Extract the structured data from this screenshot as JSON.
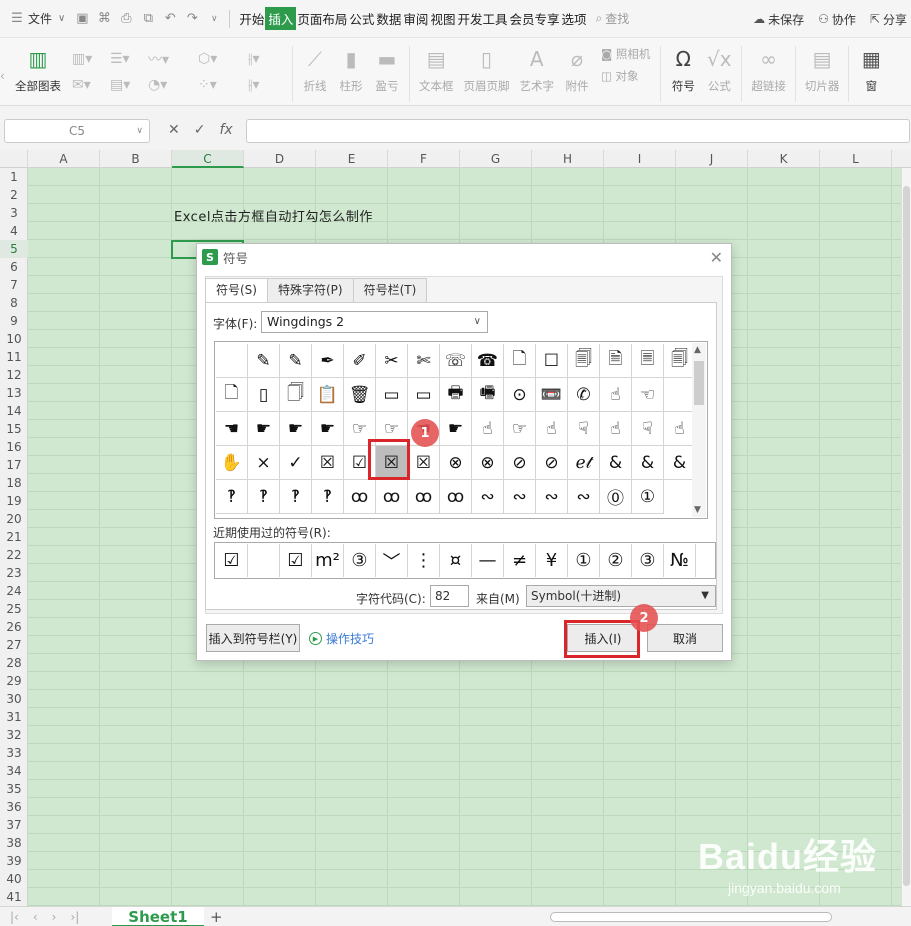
{
  "menubar": {
    "file_label": "文件",
    "tabs": [
      "开始",
      "插入",
      "页面布局",
      "公式",
      "数据",
      "审阅",
      "视图",
      "开发工具",
      "会员专享",
      "选项"
    ],
    "active_tab": "插入",
    "search_label": "查找",
    "unsaved_label": "未保存",
    "collab_label": "协作",
    "share_label": "分享"
  },
  "ribbon": {
    "all_charts": "全部图表",
    "line": "折线",
    "column": "柱形",
    "winloss": "盈亏",
    "textbox": "文本框",
    "header_footer": "页眉页脚",
    "wordart": "艺术字",
    "attachment": "附件",
    "camera": "照相机",
    "object": "对象",
    "symbol": "符号",
    "formula": "公式",
    "hyperlink": "超链接",
    "slicer": "切片器",
    "window": "窗"
  },
  "formula_bar": {
    "name_box": "C5",
    "fx": "fx",
    "value": ""
  },
  "grid": {
    "columns": [
      "A",
      "B",
      "C",
      "D",
      "E",
      "F",
      "G",
      "H",
      "I",
      "J",
      "K",
      "L"
    ],
    "selected_column": "C",
    "rows": [
      "1",
      "2",
      "3",
      "4",
      "5",
      "6",
      "7",
      "8",
      "9",
      "10",
      "11",
      "12",
      "13",
      "14",
      "15",
      "16",
      "17",
      "18",
      "19",
      "20",
      "21",
      "22",
      "23",
      "24",
      "25",
      "26",
      "27",
      "28",
      "29",
      "30",
      "31",
      "32",
      "33",
      "34",
      "35",
      "36",
      "37",
      "38",
      "39",
      "40",
      "41"
    ],
    "selected_row": "5",
    "cell_text": "Excel点击方框自动打勾怎么制作"
  },
  "sheet_tabs": {
    "active": "Sheet1",
    "add": "+"
  },
  "dialog": {
    "logo": "S",
    "title": "符号",
    "tabs": [
      "符号(S)",
      "特殊字符(P)",
      "符号栏(T)"
    ],
    "active_tab": "符号(S)",
    "font_label": "字体(F):",
    "font_value": "Wingdings 2",
    "symbols": [
      "",
      "✎",
      "✎",
      "✒",
      "✐",
      "✂",
      "✄",
      "☏",
      "☎",
      "🗋",
      "☐",
      "🗐",
      "🗎",
      "🗏",
      "🗐",
      "🗋",
      "▯",
      "🗍",
      "📋",
      "🗑",
      "▭",
      "▭",
      "🖶",
      "🖷",
      "⊙",
      "📼",
      "✆",
      "☝",
      "☜",
      "",
      "☚",
      "☛",
      "☛",
      "☛",
      "☞",
      "☞",
      "☚",
      "☛",
      "☝",
      "☞",
      "☝",
      "☟",
      "☝",
      "☟",
      "☝",
      "✋",
      "×",
      "✓",
      "☒",
      "☑",
      "☒",
      "☒",
      "⊗",
      "⊗",
      "⊘",
      "⊘",
      "ℯ𝓉",
      "&",
      "&",
      "&",
      "‽",
      "‽",
      "‽",
      "‽",
      "ꝏ",
      "ꝏ",
      "ꝏ",
      "ꝏ",
      "∾",
      "∾",
      "∾",
      "∾",
      "⓪",
      "①"
    ],
    "selected_index": 50,
    "recent_label": "近期使用过的符号(R):",
    "recent": [
      "☑",
      "",
      "☑",
      "m²",
      "③",
      "﹀",
      "⋮",
      "¤",
      "—",
      "≠",
      "¥",
      "①",
      "②",
      "③",
      "№"
    ],
    "code_label": "字符代码(C):",
    "code_value": "82",
    "from_label": "来自(M)",
    "from_value": "Symbol(十进制)",
    "insert_to_bar": "插入到符号栏(Y)",
    "tips": "操作技巧",
    "insert": "插入(I)",
    "cancel": "取消",
    "badge1": "1",
    "badge2": "2"
  },
  "watermark": {
    "brand": "Baidu经验",
    "url": "jingyan.baidu.com"
  },
  "colors": {
    "accent": "#2e9b4c",
    "highlight": "#d9262b",
    "sheet_bg": "#cfe8cf"
  }
}
